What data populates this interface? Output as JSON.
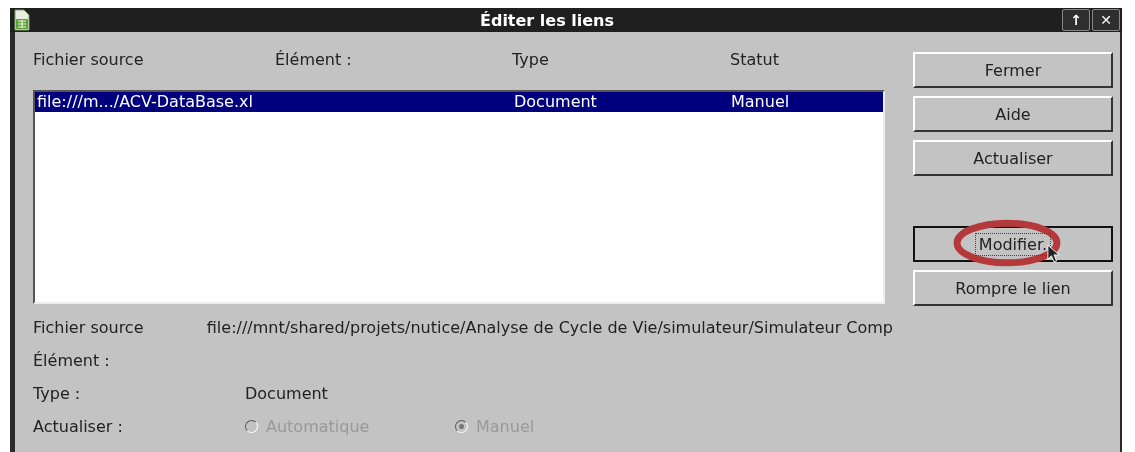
{
  "window": {
    "title": "Éditer les liens",
    "buttons": [
      "↑",
      "✕"
    ]
  },
  "columns": [
    "Fichier source",
    "Élément :",
    "Type",
    "Statut"
  ],
  "rows": [
    {
      "selected": true,
      "cells": [
        "file:///m.../ACV-DataBase.xl",
        "",
        "Document",
        "Manuel"
      ]
    }
  ],
  "buttons_top": [
    {
      "label": "Fermer",
      "focused": false
    },
    {
      "label": "Aide",
      "focused": false
    },
    {
      "label": "Actualiser",
      "focused": false
    }
  ],
  "buttons_bottom": [
    {
      "label": "Modifier.",
      "focused": true
    },
    {
      "label": "Rompre le lien",
      "focused": false
    }
  ],
  "details": [
    {
      "label": "Fichier source",
      "value": "file:///mnt/shared/projets/nutice/Analyse de Cycle de Vie/simulateur/Simulateur Comp"
    },
    {
      "label": "Élément :"
    },
    {
      "label": "Type :",
      "value": "Document"
    }
  ],
  "update": {
    "label": "Actualiser :",
    "options": [
      {
        "label": "Automatique",
        "selected": false,
        "disabled": true
      },
      {
        "label": "Manuel",
        "selected": true,
        "disabled": true
      }
    ]
  },
  "annotation": {
    "kind": "ellipse",
    "color": "#b5393b"
  }
}
